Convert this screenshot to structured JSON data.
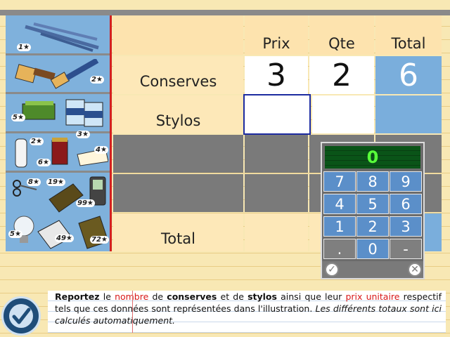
{
  "table": {
    "headers": {
      "prix": "Prix",
      "qte": "Qte",
      "total": "Total"
    },
    "rows": [
      {
        "label": "Conserves",
        "prix": "3",
        "qte": "2",
        "total": "6"
      },
      {
        "label": "Stylos",
        "prix": "",
        "qte": "",
        "total": ""
      },
      {
        "label": "",
        "prix": "",
        "qte": "",
        "total": ""
      },
      {
        "label": "",
        "prix": "",
        "qte": "",
        "total": ""
      },
      {
        "label": "Total",
        "prix": "",
        "qte": "",
        "total": ""
      }
    ]
  },
  "illustration": {
    "badges": [
      "1★",
      "2★",
      "5★",
      "3★",
      "2★",
      "6★",
      "4★",
      "8★",
      "19★",
      "99★",
      "5★",
      "49★",
      "72★"
    ],
    "items": [
      "pens",
      "paintbrushes",
      "butter",
      "cans",
      "milk bottle",
      "jam jar",
      "cheese",
      "scissors",
      "book",
      "mobile phone",
      "light bulb",
      "calculator",
      "book"
    ]
  },
  "keypad": {
    "display": "0",
    "keys": [
      "7",
      "8",
      "9",
      "4",
      "5",
      "6",
      "1",
      "2",
      "3",
      ".",
      "0",
      "-"
    ],
    "ok_icon": "check-circle-icon",
    "clear_icon": "close-circle-icon"
  },
  "instruction": {
    "w1": "Reportez",
    "w2": " le ",
    "w3": "nombre",
    "w4": " de ",
    "w5": "conserves",
    "w6": " et de ",
    "w7": "stylos",
    "w8": " ainsi que leur ",
    "w9": "prix unitaire",
    "w10": " respectif tels que ces données sont représentées dans l'illustration. ",
    "w11": "Les différents totaux sont ici calculés automatiquement."
  },
  "colors": {
    "accent_blue": "#7aaedc",
    "selection": "#1c2ba0",
    "display_green": "#58ff3a",
    "margin_red": "#d32020"
  }
}
